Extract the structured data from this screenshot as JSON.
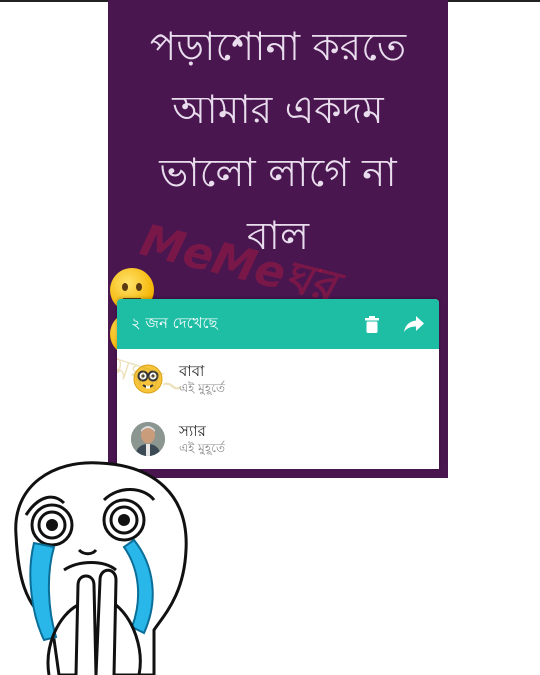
{
  "status": {
    "lines": [
      "পড়াশোনা করতে",
      "আমার একদম",
      "ভালো লাগে না",
      "বাল"
    ],
    "emojis": [
      "neutral-face-icon",
      "steaming-face-icon"
    ]
  },
  "watermark": {
    "text": "MeMeঘর",
    "text2": "~মিমঘর~"
  },
  "viewers": {
    "count_label": "২ জন দেখেছে",
    "header_icons": [
      "delete-icon",
      "forward-icon"
    ],
    "items": [
      {
        "name": "বাবা",
        "time": "এই মুহূর্তে",
        "avatar": "nerd-face-icon"
      },
      {
        "name": "স্যার",
        "time": "এই মুহূর্তে",
        "avatar": "man-photo-avatar"
      }
    ]
  },
  "colors": {
    "status_background": "#4a1650",
    "status_text": "#e8dced",
    "header_teal": "#1ebea5"
  },
  "meme_face": {
    "icon": "crying-rage-face-icon"
  }
}
